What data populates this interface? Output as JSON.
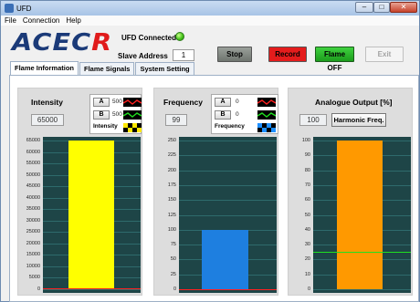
{
  "window": {
    "title": "UFD",
    "min_glyph": "–",
    "max_glyph": "□",
    "close_glyph": "✕"
  },
  "menu": [
    "File",
    "Connection",
    "Help"
  ],
  "logo": {
    "main": "ACEC",
    "accent": "R"
  },
  "status": {
    "connected_label": "UFD Connected",
    "led_color": "#3fbf16",
    "slave_label": "Slave Address",
    "slave_value": "1"
  },
  "toolbar": {
    "stop": "Stop",
    "record": "Record",
    "flame": "Flame OFF",
    "exit": "Exit"
  },
  "tabs": [
    "Flame Information",
    "Flame Signals",
    "System Setting"
  ],
  "panels": {
    "intensity": {
      "title": "Intensity",
      "value": "65000",
      "a_label": "A",
      "a_value": "500",
      "b_label": "B",
      "b_value": "500",
      "sub_label": "Intensity"
    },
    "frequency": {
      "title": "Frequency",
      "value": "99",
      "a_label": "A",
      "a_value": "0",
      "b_label": "B",
      "b_value": "0",
      "sub_label": "Frequency"
    },
    "analogue": {
      "title": "Analogue Output [%]",
      "value": "100",
      "button": "Harmonic Freq."
    }
  },
  "chart_data": [
    {
      "type": "bar",
      "name": "intensity",
      "y_ticks": [
        0,
        5000,
        10000,
        15000,
        20000,
        25000,
        30000,
        35000,
        40000,
        45000,
        50000,
        55000,
        60000,
        65000
      ],
      "ylim": [
        0,
        65000
      ],
      "value": 65000,
      "bar_color": "#ffff00",
      "line_a": 500,
      "line_b": 500
    },
    {
      "type": "bar",
      "name": "frequency",
      "y_ticks": [
        0,
        25,
        50,
        75,
        100,
        125,
        150,
        175,
        200,
        225,
        250
      ],
      "ylim": [
        0,
        250
      ],
      "value": 99,
      "bar_color": "#1e7fe0",
      "line_a": 0,
      "line_b": 0
    },
    {
      "type": "bar",
      "name": "analogue",
      "y_ticks": [
        0,
        10,
        20,
        30,
        40,
        50,
        60,
        70,
        80,
        90,
        100
      ],
      "ylim": [
        0,
        100
      ],
      "value": 100,
      "bar_color": "#ff9900",
      "line_a": 25
    }
  ]
}
